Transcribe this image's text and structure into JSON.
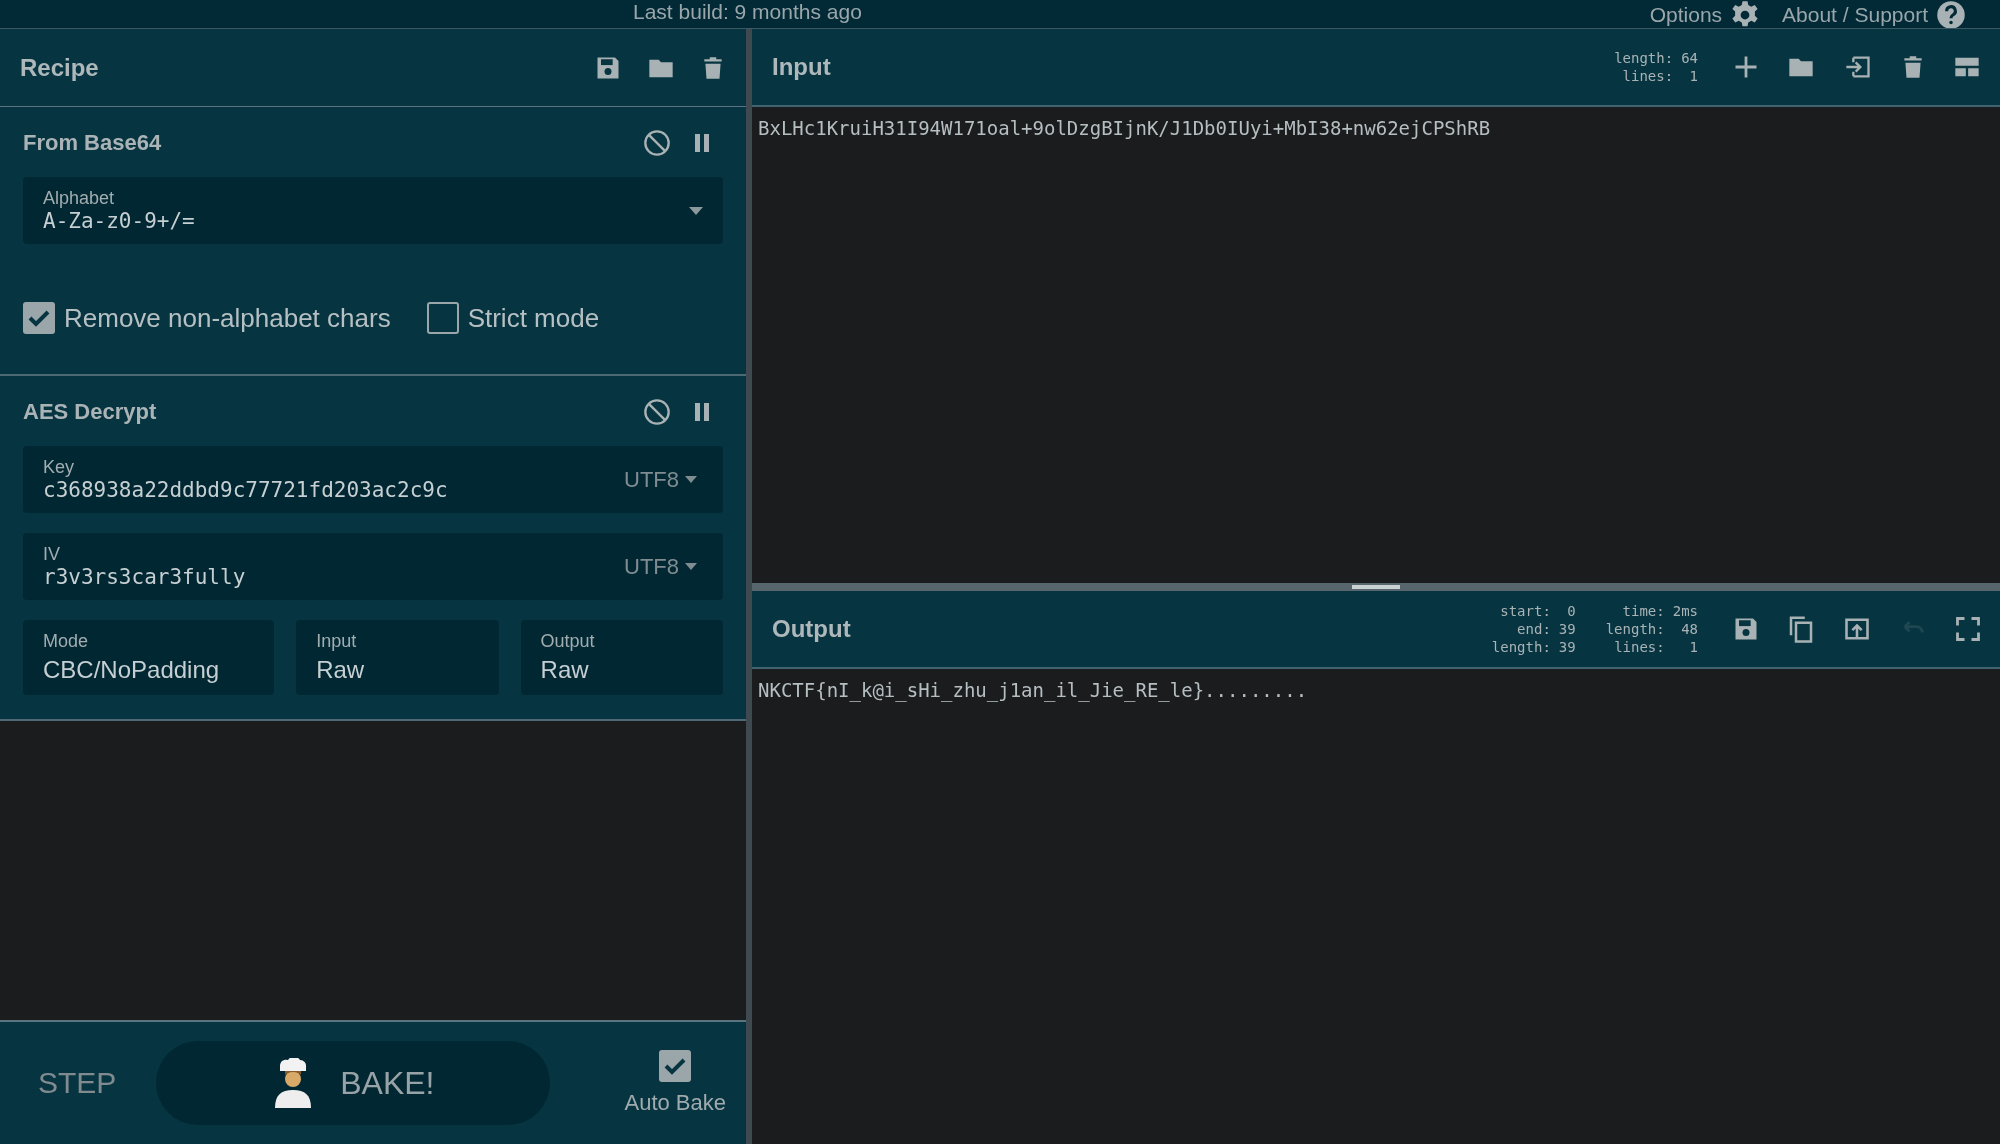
{
  "top_bar": {
    "last_build": "Last build: 9 months ago",
    "options": "Options",
    "about": "About / Support"
  },
  "recipe": {
    "title": "Recipe",
    "tools": [
      {
        "kind": "save"
      },
      {
        "kind": "folder"
      },
      {
        "kind": "trash"
      }
    ],
    "operations": [
      {
        "name": "From Base64",
        "rows": [
          [
            {
              "kind": "dropdown",
              "label": "Alphabet",
              "value": "A-Za-z0-9+/="
            }
          ],
          [
            {
              "kind": "checkbox",
              "label": "Remove non-alphabet chars",
              "checked": true
            },
            {
              "kind": "checkbox",
              "label": "Strict mode",
              "checked": false
            }
          ]
        ]
      },
      {
        "name": "AES Decrypt",
        "rows": [
          [
            {
              "kind": "toggle",
              "label": "Key",
              "value": "c368938a22ddbd9c77721fd203ac2c9c",
              "encoding": "UTF8"
            }
          ],
          [
            {
              "kind": "toggle",
              "label": "IV",
              "value": "r3v3rs3car3fully",
              "encoding": "UTF8"
            }
          ],
          [
            {
              "kind": "select",
              "label": "Mode",
              "value": "CBC/NoPadding"
            },
            {
              "kind": "select",
              "label": "Input",
              "value": "Raw"
            },
            {
              "kind": "select",
              "label": "Output",
              "value": "Raw"
            }
          ]
        ]
      }
    ]
  },
  "controls": {
    "step": "STEP",
    "bake": "BAKE!",
    "auto_bake": {
      "label": "Auto Bake",
      "checked": true
    }
  },
  "input": {
    "title": "Input",
    "stat_columns": [
      [
        {
          "label": "length:",
          "value": "64"
        },
        {
          "label": "lines:",
          "value": "1"
        }
      ]
    ],
    "tools": [
      {
        "kind": "add",
        "disabled": false
      },
      {
        "kind": "folder",
        "disabled": false
      },
      {
        "kind": "import",
        "disabled": false
      },
      {
        "kind": "trash",
        "disabled": false
      },
      {
        "kind": "layout",
        "disabled": false
      }
    ],
    "text": "BxLHc1KruiH31I94W171oal+9olDzgBIjnK/J1Db0IUyi+MbI38+nw62ejCPShRB"
  },
  "output": {
    "title": "Output",
    "stat_columns": [
      [
        {
          "label": "start:",
          "value": "0"
        },
        {
          "label": "end:",
          "value": "39"
        },
        {
          "label": "length:",
          "value": "39"
        }
      ],
      [
        {
          "label": "time:",
          "value": "2ms"
        },
        {
          "label": "length:",
          "value": "48"
        },
        {
          "label": "lines:",
          "value": "1"
        }
      ]
    ],
    "tools": [
      {
        "kind": "save",
        "disabled": false
      },
      {
        "kind": "copy",
        "disabled": false
      },
      {
        "kind": "export",
        "disabled": false
      },
      {
        "kind": "undo",
        "disabled": true
      },
      {
        "kind": "maximise",
        "disabled": false
      }
    ],
    "text": "NKCTF{nI_k@i_sHi_zhu_j1an_il_Jie_RE_le}........."
  }
}
